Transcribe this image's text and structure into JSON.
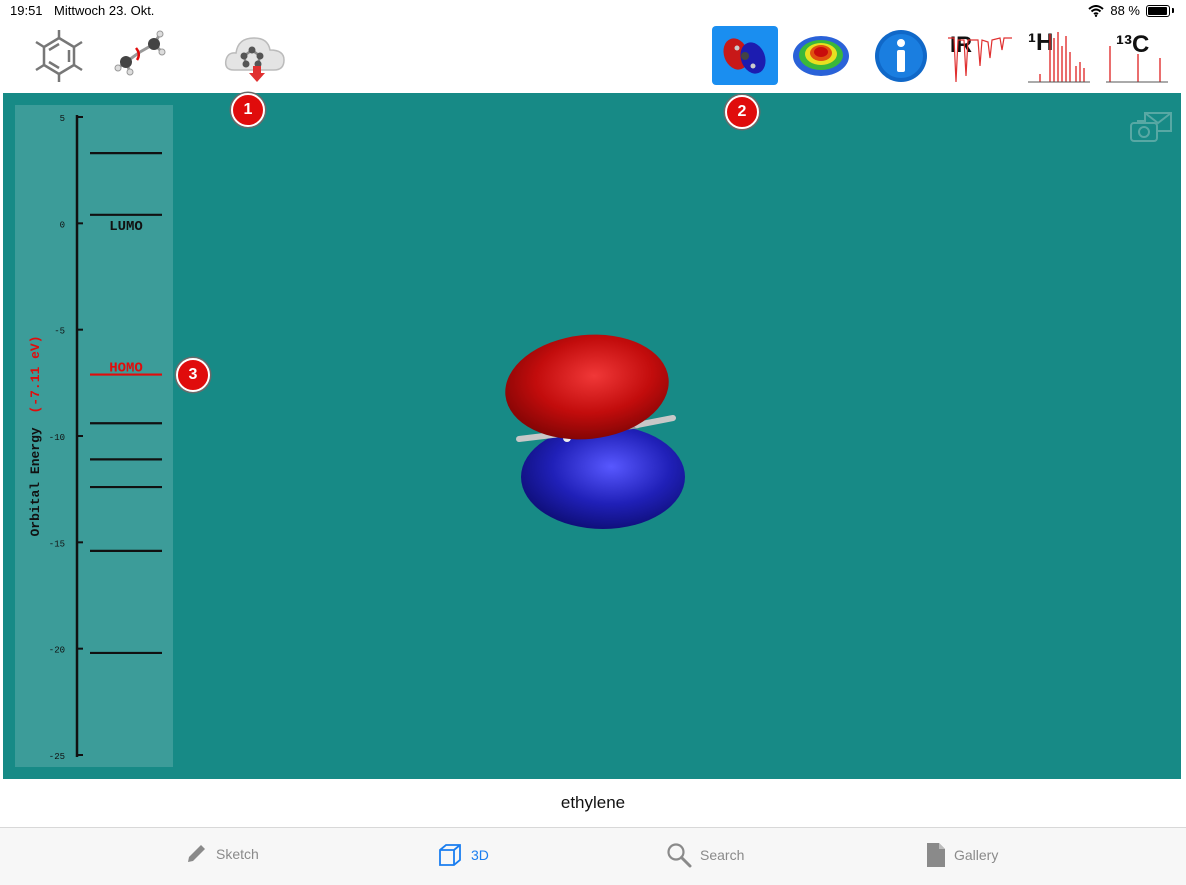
{
  "status_bar": {
    "time": "19:51",
    "date": "Mittwoch 23. Okt.",
    "battery": "88 %"
  },
  "toolbar": {
    "left_icons": [
      "benzene-sketch-icon",
      "molecule-rotate-icon",
      "cloud-download-icon"
    ],
    "right_icons": [
      "orbital-icon",
      "electrostatic-map-icon",
      "info-icon",
      "ir-spectrum-icon",
      "h1-nmr-icon",
      "c13-nmr-icon"
    ],
    "ir_label": "IR",
    "h_nmr_label": "¹H",
    "c_nmr_label": "¹³C"
  },
  "markers": [
    "1",
    "2",
    "3"
  ],
  "energy_diagram": {
    "axis_label": "Orbital Energy",
    "selected_energy": "(-7.11 eV)",
    "ticks": [
      "5",
      "0",
      "-5",
      "-10",
      "-15",
      "-20",
      "-25"
    ],
    "levels_ev": [
      3.3,
      0.4,
      -7.11,
      -9.4,
      -11.1,
      -12.4,
      -15.4,
      -20.2
    ],
    "lumo_label": "LUMO",
    "homo_label": "HOMO",
    "homo_color": "#e00c0c",
    "range": [
      -25,
      5
    ]
  },
  "viewer": {
    "background": "#178a86",
    "camera_icon": "camera-email-icon"
  },
  "molecule_name": "ethylene",
  "tabs": [
    {
      "label": "Sketch",
      "icon": "pencil-icon",
      "active": false
    },
    {
      "label": "3D",
      "icon": "cube-icon",
      "active": true
    },
    {
      "label": "Search",
      "icon": "search-icon",
      "active": false
    },
    {
      "label": "Gallery",
      "icon": "document-icon",
      "active": false
    }
  ]
}
